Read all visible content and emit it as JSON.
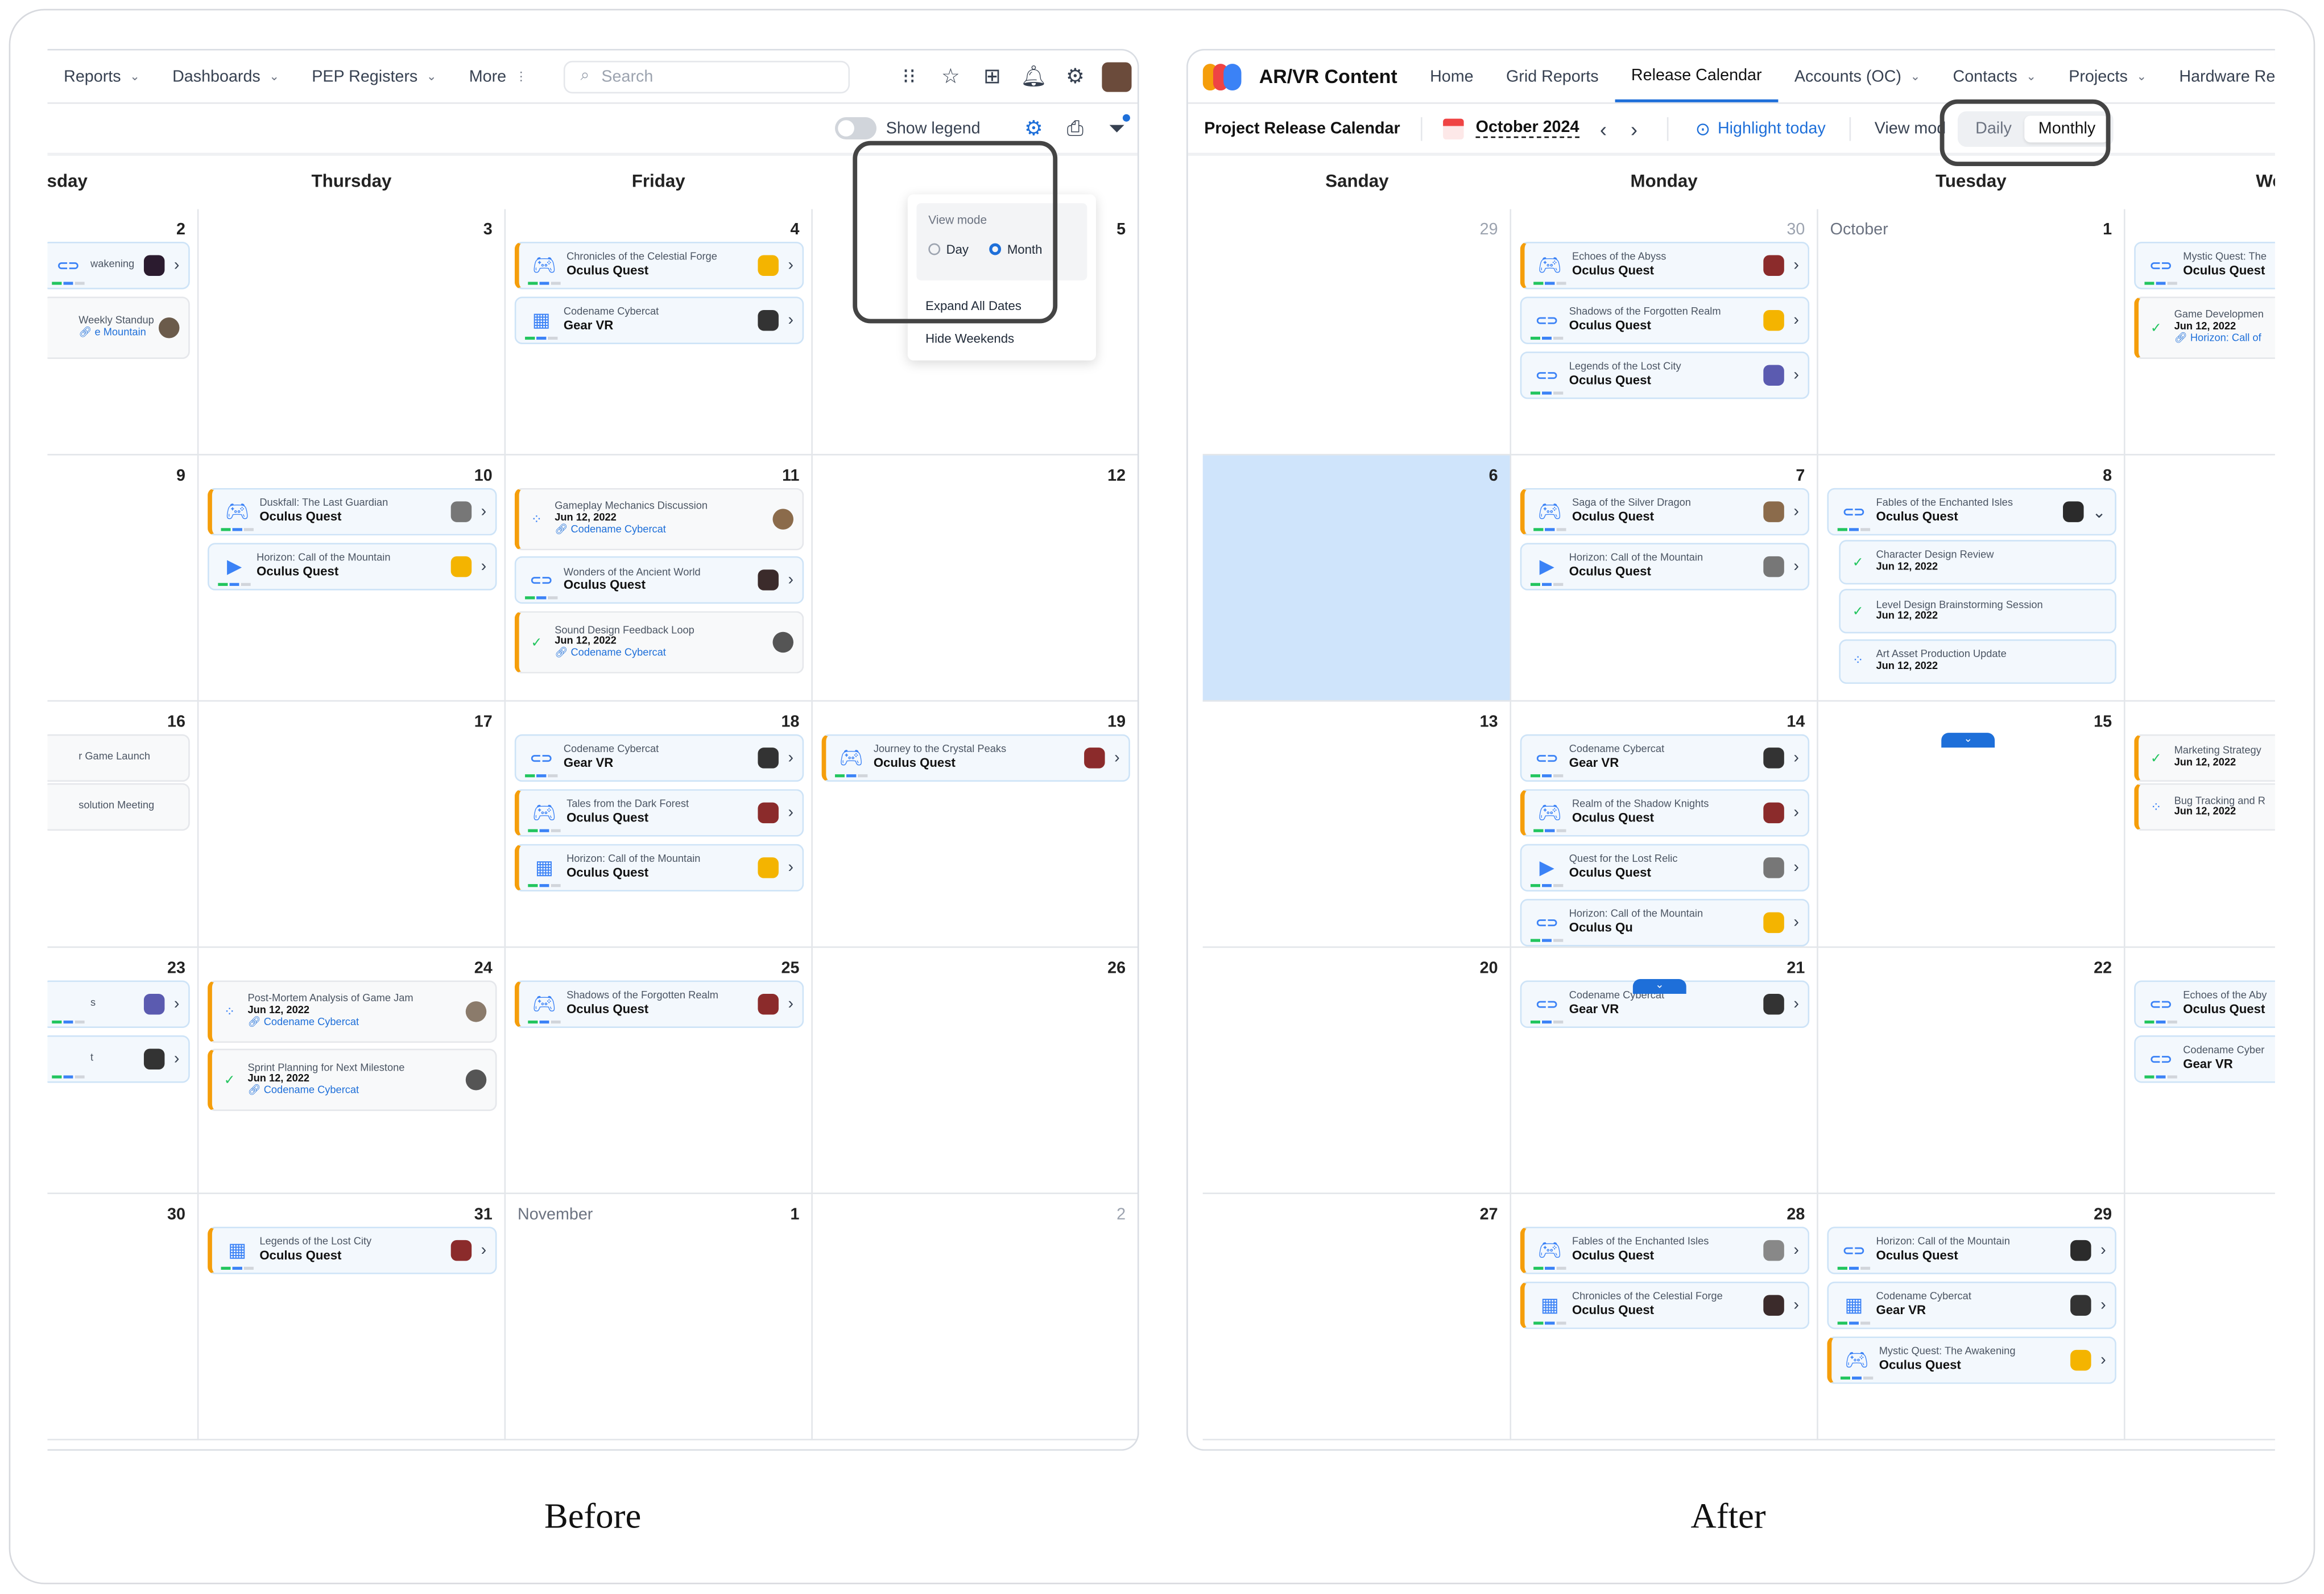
{
  "captions": {
    "before": "Before",
    "after": "After"
  },
  "colors": {
    "accent": "#1e6fd9",
    "event_border": "#f59e0b",
    "today_highlight": "#cfe4fb"
  },
  "before": {
    "nav": {
      "items": [
        "Reports",
        "Dashboards",
        "PEP Registers",
        "More"
      ],
      "search_placeholder": "Search"
    },
    "toolbar": {
      "show_legend": "Show legend"
    },
    "dropdown": {
      "title": "View mode",
      "day": "Day",
      "month": "Month",
      "selected": "Month",
      "expand": "Expand All Dates",
      "hide": "Hide Weekends"
    },
    "weekdays": [
      "esday",
      "Thursday",
      "Friday"
    ],
    "rows": [
      {
        "days": [
          {
            "n": "2"
          },
          {
            "n": "3"
          },
          {
            "n": "4"
          },
          {
            "n": "5"
          }
        ]
      },
      {
        "days": [
          {
            "n": "9"
          },
          {
            "n": "10"
          },
          {
            "n": "11"
          },
          {
            "n": "12"
          }
        ]
      },
      {
        "days": [
          {
            "n": "16"
          },
          {
            "n": "17"
          },
          {
            "n": "18"
          },
          {
            "n": "19"
          }
        ]
      },
      {
        "days": [
          {
            "n": "23"
          },
          {
            "n": "24"
          },
          {
            "n": "25"
          },
          {
            "n": "26"
          }
        ]
      },
      {
        "days": [
          {
            "n": "30"
          },
          {
            "n": "31"
          },
          {
            "n": "1",
            "month": "November"
          },
          {
            "n": "2",
            "muted": true
          }
        ]
      }
    ],
    "events": [
      {
        "r": 0,
        "c": 0,
        "slot": 0,
        "t": "release",
        "l1": "wakening",
        "l2": "",
        "icon": "headset",
        "ob": false,
        "avc": "#2b1b2f"
      },
      {
        "r": 0,
        "c": 0,
        "slot": 1,
        "t": "task",
        "l1": "Weekly Standup",
        "l3": "e Mountain",
        "ob": false,
        "avc": "#6b5b4b"
      },
      {
        "r": 0,
        "c": 2,
        "slot": 0,
        "t": "release",
        "l1": "Chronicles of the Celestial Forge",
        "l2": "Oculus Quest",
        "icon": "gamepad",
        "ob": true,
        "avc": "#f4b400"
      },
      {
        "r": 0,
        "c": 2,
        "slot": 1,
        "t": "release",
        "l1": "Codename Cybercat",
        "l2": "Gear VR",
        "icon": "grid",
        "ob": false,
        "avc": "#333"
      },
      {
        "r": 1,
        "c": 1,
        "slot": 0,
        "t": "release",
        "l1": "Duskfall: The Last Guardian",
        "l2": "Oculus Quest",
        "icon": "gamepad",
        "ob": true,
        "avc": "#777"
      },
      {
        "r": 1,
        "c": 1,
        "slot": 1,
        "t": "release",
        "l1": "Horizon: Call of the Mountain",
        "l2": "Oculus Quest",
        "icon": "play",
        "ob": false,
        "avc": "#f4b400"
      },
      {
        "r": 1,
        "c": 2,
        "slot": 0,
        "t": "task",
        "l1": "Gameplay Mechanics Discussion",
        "l2": "Jun 12, 2022",
        "l3": "Codename Cybercat",
        "status": "progress",
        "ob": true,
        "avc": "#8b6b4b"
      },
      {
        "r": 1,
        "c": 2,
        "slot": 1.25,
        "t": "release",
        "l1": "Wonders of the Ancient World",
        "l2": "Oculus Quest",
        "icon": "headset",
        "ob": false,
        "avc": "#3b2b2b"
      },
      {
        "r": 1,
        "c": 2,
        "slot": 2.25,
        "t": "task",
        "l1": "Sound Design Feedback Loop",
        "l2": "Jun 12, 2022",
        "l3": "Codename Cybercat",
        "status": "done",
        "ob": true,
        "avc": "#555"
      },
      {
        "r": 2,
        "c": 0,
        "slot": 0,
        "t": "task",
        "l1": "r Game Launch",
        "ob": false,
        "avc": "none"
      },
      {
        "r": 2,
        "c": 0,
        "slot": 0.9,
        "t": "task",
        "l1": "solution Meeting",
        "ob": false,
        "avc": "none"
      },
      {
        "r": 2,
        "c": 2,
        "slot": 0,
        "t": "release",
        "l1": "Codename Cybercat",
        "l2": "Gear VR",
        "icon": "headset",
        "ob": false,
        "avc": "#333"
      },
      {
        "r": 2,
        "c": 2,
        "slot": 1,
        "t": "release",
        "l1": "Tales from the Dark Forest",
        "l2": "Oculus Quest",
        "icon": "gamepad",
        "ob": true,
        "avc": "#8b2b2b"
      },
      {
        "r": 2,
        "c": 2,
        "slot": 2,
        "t": "release",
        "l1": "Horizon: Call of the Mountain",
        "l2": "Oculus Quest",
        "icon": "grid",
        "ob": true,
        "avc": "#f4b400"
      },
      {
        "r": 2,
        "c": 3,
        "slot": 0,
        "t": "release",
        "l1": "Journey to the Crystal Peaks",
        "l2": "Oculus Quest",
        "icon": "gamepad",
        "ob": true,
        "avc": "#8b2b2b"
      },
      {
        "r": 3,
        "c": 0,
        "slot": 0,
        "t": "release",
        "l1": "s",
        "l2": "",
        "icon": "none",
        "ob": false,
        "avc": "#5b5bb0"
      },
      {
        "r": 3,
        "c": 0,
        "slot": 1,
        "t": "release",
        "l1": "t",
        "l2": "",
        "icon": "none",
        "ob": false,
        "avc": "#333"
      },
      {
        "r": 3,
        "c": 1,
        "slot": 0,
        "t": "task",
        "l1": "Post-Mortem Analysis of Game Jam",
        "l2": "Jun 12, 2022",
        "l3": "Codename Cybercat",
        "status": "progress",
        "ob": true,
        "avc": "#8b7b6b"
      },
      {
        "r": 3,
        "c": 1,
        "slot": 1.25,
        "t": "task",
        "l1": "Sprint Planning for Next Milestone",
        "l2": "Jun 12, 2022",
        "l3": "Codename Cybercat",
        "status": "done",
        "ob": true,
        "avc": "#555"
      },
      {
        "r": 3,
        "c": 2,
        "slot": 0,
        "t": "release",
        "l1": "Shadows of the Forgotten Realm",
        "l2": "Oculus Quest",
        "icon": "gamepad",
        "ob": true,
        "avc": "#8b2b2b"
      },
      {
        "r": 4,
        "c": 1,
        "slot": 0,
        "t": "release",
        "l1": "Legends of the Lost City",
        "l2": "Oculus Quest",
        "icon": "grid",
        "ob": true,
        "avc": "#8b2b2b"
      }
    ]
  },
  "after": {
    "brand": "AR/VR Content",
    "nav": {
      "items": [
        "Home",
        "Grid Reports",
        "Release Calendar",
        "Accounts (OC)",
        "Contacts",
        "Projects",
        "Hardware Requests"
      ],
      "active": "Release Calendar"
    },
    "toolbar": {
      "title": "Project Release Calendar",
      "month": "October 2024",
      "highlight": "Highlight today",
      "view_mode": "View mod",
      "daily": "Daily",
      "monthly": "Monthly"
    },
    "weekdays": [
      "Sanday",
      "Monday",
      "Tuesday",
      "Wedr"
    ],
    "rows": [
      {
        "days": [
          {
            "n": "29",
            "muted": true
          },
          {
            "n": "30",
            "muted": true
          },
          {
            "n": "1",
            "month": "October"
          },
          {
            "n": ""
          }
        ]
      },
      {
        "days": [
          {
            "n": "6",
            "highlight": true
          },
          {
            "n": "7"
          },
          {
            "n": "8"
          },
          {
            "n": ""
          }
        ]
      },
      {
        "days": [
          {
            "n": "13"
          },
          {
            "n": "14"
          },
          {
            "n": "15"
          },
          {
            "n": ""
          }
        ]
      },
      {
        "days": [
          {
            "n": "20"
          },
          {
            "n": "21"
          },
          {
            "n": "22"
          },
          {
            "n": ""
          }
        ]
      },
      {
        "days": [
          {
            "n": "27"
          },
          {
            "n": "28"
          },
          {
            "n": "29"
          },
          {
            "n": ""
          }
        ]
      }
    ],
    "events": [
      {
        "r": 0,
        "c": 1,
        "slot": 0,
        "t": "release",
        "l1": "Echoes of the Abyss",
        "l2": "Oculus Quest",
        "icon": "gamepad",
        "ob": true,
        "avc": "#8b2b2b"
      },
      {
        "r": 0,
        "c": 1,
        "slot": 1,
        "t": "release",
        "l1": "Shadows of the Forgotten Realm",
        "l2": "Oculus Quest",
        "icon": "headset",
        "ob": false,
        "avc": "#f4b400"
      },
      {
        "r": 0,
        "c": 1,
        "slot": 2,
        "t": "release",
        "l1": "Legends of the Lost City",
        "l2": "Oculus Quest",
        "icon": "headset",
        "ob": false,
        "avc": "#5b5bb0"
      },
      {
        "r": 0,
        "c": 3,
        "slot": 0,
        "t": "release",
        "l1": "Mystic Quest: The",
        "l2": "Oculus Quest",
        "icon": "headset",
        "ob": false,
        "avc": "none"
      },
      {
        "r": 0,
        "c": 3,
        "slot": 1,
        "t": "task",
        "l1": "Game Developmen",
        "l2": "Jun 12, 2022",
        "l3": "Horizon: Call of",
        "status": "done",
        "ob": true,
        "avc": "none"
      },
      {
        "r": 1,
        "c": 1,
        "slot": 0,
        "t": "release",
        "l1": "Saga of the Silver Dragon",
        "l2": "Oculus Quest",
        "icon": "gamepad",
        "ob": true,
        "avc": "#8b6b4b"
      },
      {
        "r": 1,
        "c": 1,
        "slot": 1,
        "t": "release",
        "l1": "Horizon: Call of the Mountain",
        "l2": "Oculus Quest",
        "icon": "play",
        "ob": false,
        "avc": "#777"
      },
      {
        "r": 1,
        "c": 2,
        "slot": 0,
        "t": "release",
        "l1": "Fables of the Enchanted Isles",
        "l2": "Oculus Quest",
        "icon": "headset",
        "ob": false,
        "avc": "#2b2b2b",
        "expanded": true
      },
      {
        "r": 1,
        "c": 2,
        "slot": 0.95,
        "t": "subtask",
        "l1": "Character Design Review",
        "l2": "Jun 12, 2022",
        "status": "done"
      },
      {
        "r": 1,
        "c": 2,
        "slot": 1.85,
        "t": "subtask",
        "l1": "Level Design Brainstorming Session",
        "l2": "Jun 12, 2022",
        "status": "done"
      },
      {
        "r": 1,
        "c": 2,
        "slot": 2.75,
        "t": "subtask",
        "l1": "Art Asset Production Update",
        "l2": "Jun 12, 2022",
        "status": "progress"
      },
      {
        "r": 2,
        "c": 1,
        "slot": 0,
        "t": "release",
        "l1": "Codename Cybercat",
        "l2": "Gear VR",
        "icon": "headset",
        "ob": false,
        "avc": "#333"
      },
      {
        "r": 2,
        "c": 1,
        "slot": 1,
        "t": "release",
        "l1": "Realm of the Shadow Knights",
        "l2": "Oculus Quest",
        "icon": "gamepad",
        "ob": true,
        "avc": "#8b2b2b"
      },
      {
        "r": 2,
        "c": 1,
        "slot": 2,
        "t": "release",
        "l1": "Quest for the Lost Relic",
        "l2": "Oculus Quest",
        "icon": "play",
        "ob": false,
        "avc": "#777"
      },
      {
        "r": 2,
        "c": 1,
        "slot": 3,
        "t": "release",
        "l1": "Horizon: Call of the Mountain",
        "l2": "Oculus Qu",
        "icon": "headset",
        "ob": false,
        "avc": "#f4b400"
      },
      {
        "r": 2,
        "c": 3,
        "slot": 0,
        "t": "task",
        "l1": "Marketing Strategy",
        "l2": "Jun 12, 2022",
        "status": "done",
        "ob": true,
        "avc": "none"
      },
      {
        "r": 2,
        "c": 3,
        "slot": 0.9,
        "t": "task",
        "l1": "Bug Tracking and R",
        "l2": "Jun 12, 2022",
        "status": "progress",
        "ob": true,
        "avc": "none"
      },
      {
        "r": 3,
        "c": 1,
        "slot": 0,
        "t": "release",
        "l1": "Codename Cybercat",
        "l2": "Gear VR",
        "icon": "headset",
        "ob": false,
        "avc": "#333"
      },
      {
        "r": 3,
        "c": 3,
        "slot": 0,
        "t": "release",
        "l1": "Echoes of the Aby",
        "l2": "Oculus Quest",
        "icon": "headset",
        "ob": false,
        "avc": "none"
      },
      {
        "r": 3,
        "c": 3,
        "slot": 1,
        "t": "release",
        "l1": "Codename Cyber",
        "l2": "Gear VR",
        "icon": "headset",
        "ob": false,
        "avc": "none"
      },
      {
        "r": 4,
        "c": 1,
        "slot": 0,
        "t": "release",
        "l1": "Fables of the Enchanted Isles",
        "l2": "Oculus Quest",
        "icon": "gamepad",
        "ob": true,
        "avc": "#888"
      },
      {
        "r": 4,
        "c": 1,
        "slot": 1,
        "t": "release",
        "l1": "Chronicles of the Celestial Forge",
        "l2": "Oculus Quest",
        "icon": "grid",
        "ob": true,
        "avc": "#3b2b2b"
      },
      {
        "r": 4,
        "c": 2,
        "slot": 0,
        "t": "release",
        "l1": "Horizon: Call of the Mountain",
        "l2": "Oculus Quest",
        "icon": "headset",
        "ob": false,
        "avc": "#2b2b2b"
      },
      {
        "r": 4,
        "c": 2,
        "slot": 1,
        "t": "release",
        "l1": "Codename Cybercat",
        "l2": "Gear VR",
        "icon": "grid",
        "ob": false,
        "avc": "#333"
      },
      {
        "r": 4,
        "c": 2,
        "slot": 2,
        "t": "release",
        "l1": "Mystic Quest: The Awakening",
        "l2": "Oculus Quest",
        "icon": "gamepad",
        "ob": true,
        "avc": "#f4b400"
      }
    ]
  }
}
